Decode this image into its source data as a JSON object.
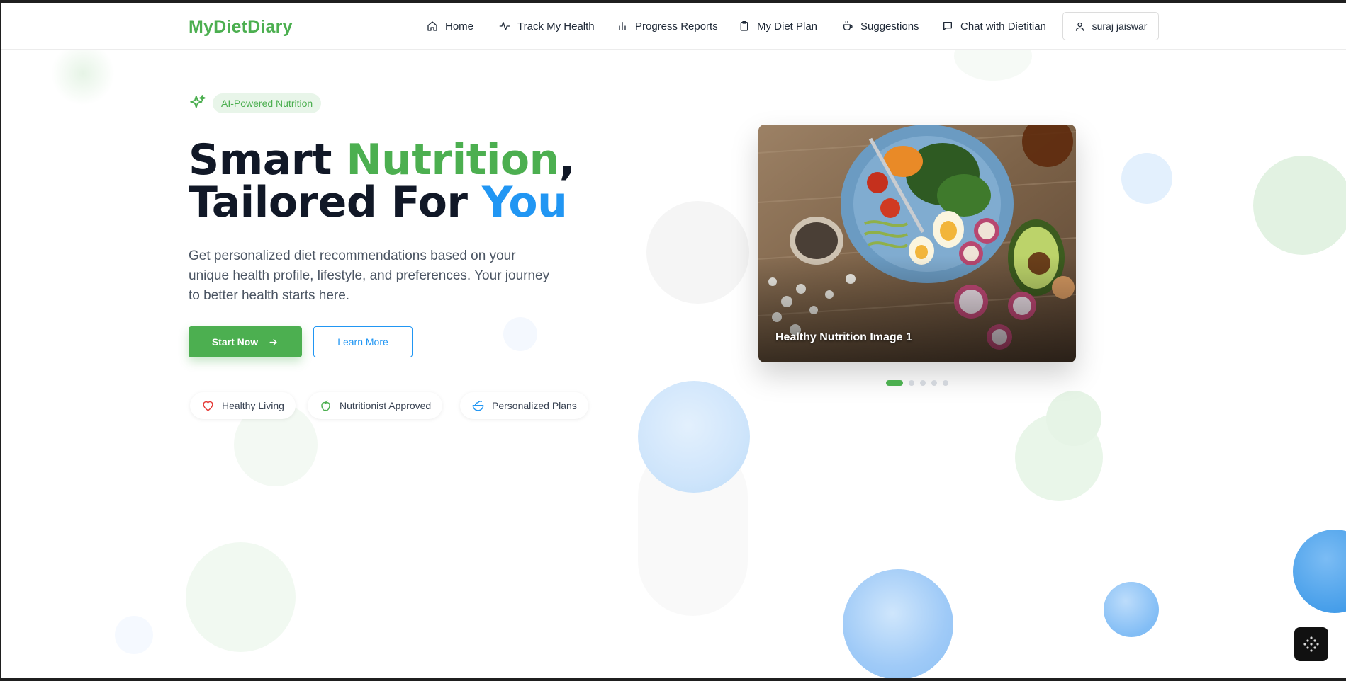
{
  "header": {
    "brand": "MyDietDiary",
    "nav": [
      {
        "label": "Home",
        "icon": "home-icon"
      },
      {
        "label": "Track My Health",
        "icon": "activity-icon"
      },
      {
        "label": "Progress Reports",
        "icon": "bar-chart-icon"
      },
      {
        "label": "My Diet Plan",
        "icon": "clipboard-icon"
      },
      {
        "label": "Suggestions",
        "icon": "coffee-icon"
      },
      {
        "label": "Chat with Dietitian",
        "icon": "chat-icon"
      }
    ],
    "user": {
      "name": "suraj jaiswar",
      "icon": "user-icon"
    }
  },
  "hero": {
    "badge": "AI-Powered Nutrition",
    "title_part1": "Smart ",
    "title_part2": "Nutrition",
    "title_part3": ",",
    "title_part4": "Tailored For ",
    "title_part5": "You",
    "description": "Get personalized diet recommendations based on your unique health profile, lifestyle, and preferences. Your journey to better health starts here.",
    "start_label": "Start Now",
    "learn_label": "Learn More",
    "features": [
      {
        "label": "Healthy Living",
        "icon": "heart-icon"
      },
      {
        "label": "Nutritionist Approved",
        "icon": "apple-icon"
      },
      {
        "label": "Personalized Plans",
        "icon": "salad-icon"
      }
    ]
  },
  "carousel": {
    "caption": "Healthy Nutrition Image 1",
    "slides": 5,
    "active": 1
  },
  "colors": {
    "brand_green": "#4caf50",
    "accent_blue": "#2196f3",
    "text_dark": "#111827"
  }
}
